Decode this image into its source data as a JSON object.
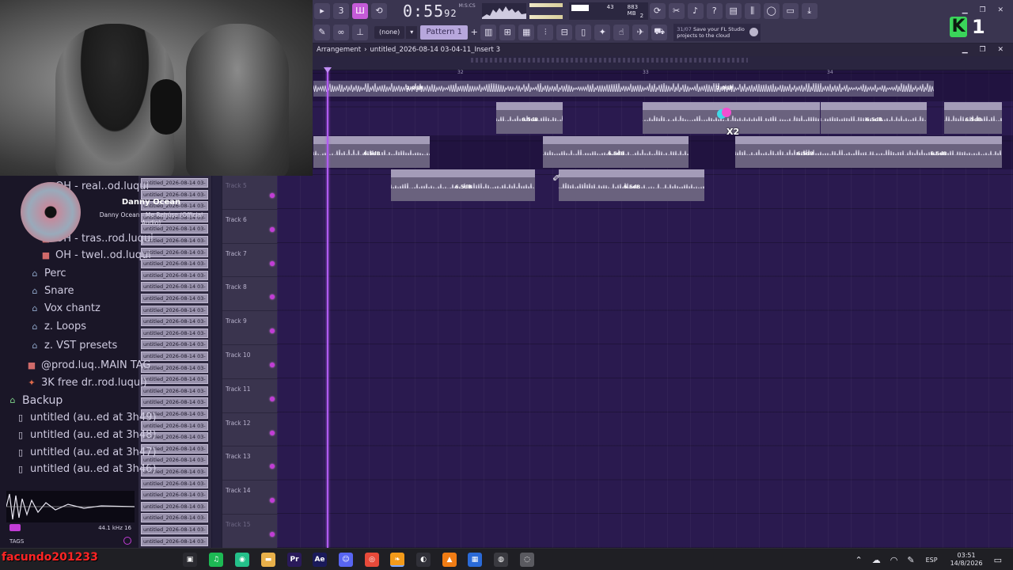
{
  "toolbar": {
    "time": "0:55",
    "time_sub": "92",
    "time_label": "M:S:CS",
    "pattern_label": "Pattern 1",
    "snap_value": "(none)",
    "cpu_value": "43",
    "memory_value": "883 MB",
    "polyphony_value": "2",
    "news_count": "31/07",
    "news_text": "Save your FL Studio projects to the cloud"
  },
  "logo": {
    "letter": "K",
    "number": "1"
  },
  "playlist": {
    "title": "Arrangement",
    "file": "untitled_2026-08-14 03-04-11_Insert 3",
    "bar_numbers": [
      "32",
      "33",
      "34"
    ],
    "tracks": [
      {
        "name": "Track 5"
      },
      {
        "name": "Track 6"
      },
      {
        "name": "Track 7"
      },
      {
        "name": "Track 8"
      },
      {
        "name": "Track 9"
      },
      {
        "name": "Track 10"
      },
      {
        "name": "Track 11"
      },
      {
        "name": "Track 12"
      },
      {
        "name": "Track 13"
      },
      {
        "name": "Track 14"
      },
      {
        "name": "Track 15"
      }
    ],
    "clips": [
      {
        "label": "",
        "db": "2.0dB"
      },
      {
        "label": "",
        "db": "2.0dB"
      },
      {
        "label": "untitled_202_56_Insert 3",
        "db": "6.5dB"
      },
      {
        "label": "untitled_2026-08-14 03-1_58_Insert 3",
        "db": ""
      },
      {
        "label": "untitled_2026-08-14 03-19-13_Insert 3",
        "db": "6.5dB"
      },
      {
        "label": "untitled_2..._Insert 3",
        "db": "6.5dB"
      },
      {
        "label": "2026-08-14 03-10-26_Insert 3",
        "db": "6.5dB"
      },
      {
        "label": "untitled_2026-08-14 03-11-25_Insert 3",
        "db": "6.5dB"
      },
      {
        "label": "untitled_2026-08-14 03-16-33_Insert 3",
        "db": "6.5dB"
      },
      {
        "label": "untitled_2026-08-14 03-19-15_Insert 3",
        "db": "6.5dB"
      },
      {
        "label": "untitled_2026-08-14 03-10-39_Insert 3",
        "db": "6.5dB"
      },
      {
        "label": "untitled_2026-08-14 03-15-53_Insert 3",
        "db": "6.5dB"
      }
    ],
    "overlay_text": "X2"
  },
  "browser": {
    "items": [
      {
        "label": "OH - real..od.luqui",
        "icon": "audio-file-icon"
      },
      {
        "label": "OH - tras..rod.luqui",
        "icon": "audio-file-icon"
      },
      {
        "label": "OH - twel..od.luqui",
        "icon": "audio-file-icon"
      },
      {
        "label": "Perc",
        "icon": "folder-icon"
      },
      {
        "label": "Snare",
        "icon": "folder-icon"
      },
      {
        "label": "Vox chantz",
        "icon": "folder-icon"
      },
      {
        "label": "z. Loops",
        "icon": "folder-icon"
      },
      {
        "label": "z. VST presets",
        "icon": "folder-icon"
      },
      {
        "label": "@prod.luq..MAIN TAG",
        "icon": "audio-file-icon"
      },
      {
        "label": "3K free dr..rod.luqui)",
        "icon": "plugin-icon"
      },
      {
        "label": "Backup",
        "icon": "open-folder-icon"
      },
      {
        "label": "untitled (au..ed at 3h49)",
        "icon": "project-icon"
      },
      {
        "label": "untitled (au..ed at 3h48)",
        "icon": "project-icon"
      },
      {
        "label": "untitled (au..ed at 3h47)",
        "icon": "project-icon"
      },
      {
        "label": "untitled (au..ed at 3h46)",
        "icon": "project-icon"
      }
    ],
    "preview_rate": "44.1 kHz 16",
    "tags_label": "TAGS"
  },
  "pattern_list": {
    "chip_label": "untitled_2026-08-14 03-",
    "count": 32
  },
  "now_playing": {
    "artist": "Danny Ocean",
    "title": "Danny Ocean - Me Rehúso (Official Audio)"
  },
  "taskbar": {
    "username": "facundo201233",
    "apps": [
      {
        "name": "task-view",
        "label": "▣"
      },
      {
        "name": "spotify",
        "label": "♫"
      },
      {
        "name": "app-green",
        "label": "◉"
      },
      {
        "name": "file-explorer",
        "label": "▬"
      },
      {
        "name": "premiere",
        "label": "Pr"
      },
      {
        "name": "after-effects",
        "label": "Ae"
      },
      {
        "name": "discord",
        "label": "☺"
      },
      {
        "name": "chrome",
        "label": "◎"
      },
      {
        "name": "fl-studio",
        "label": "❧"
      },
      {
        "name": "obs",
        "label": "◐"
      },
      {
        "name": "vlc",
        "label": "▲"
      },
      {
        "name": "calculator",
        "label": "▦"
      },
      {
        "name": "media-app",
        "label": "◍"
      },
      {
        "name": "misc-app",
        "label": "◌"
      }
    ],
    "language": "ESP",
    "time": "03:51",
    "date": "14/8/2026"
  },
  "colors": {
    "grid_bg": "#2a1a4f",
    "accent": "#c45bd8",
    "clip_body": "#6a627e",
    "clip_header": "#a49cb8",
    "username": "#ff2525"
  }
}
